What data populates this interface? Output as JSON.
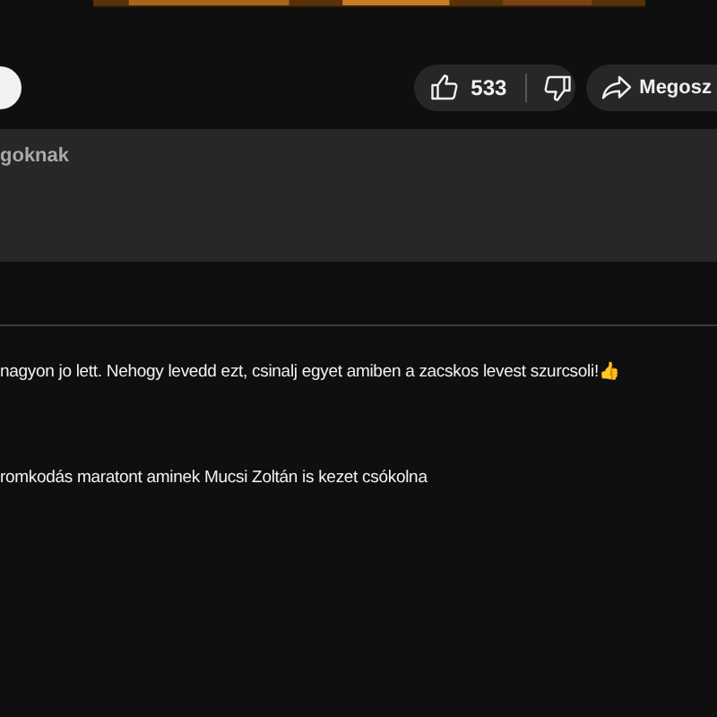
{
  "actions": {
    "likes": "533",
    "share": "Megosz"
  },
  "description": {
    "text": "goknak"
  },
  "comments": [
    {
      "text": "nagyon jo lett. Nehogy levedd ezt, csinalj egyet amiben a zacskos levest szurcsoli!👍"
    },
    {
      "text": "romkodás maratont aminek Mucsi Zoltán is kezet csókolna"
    }
  ]
}
